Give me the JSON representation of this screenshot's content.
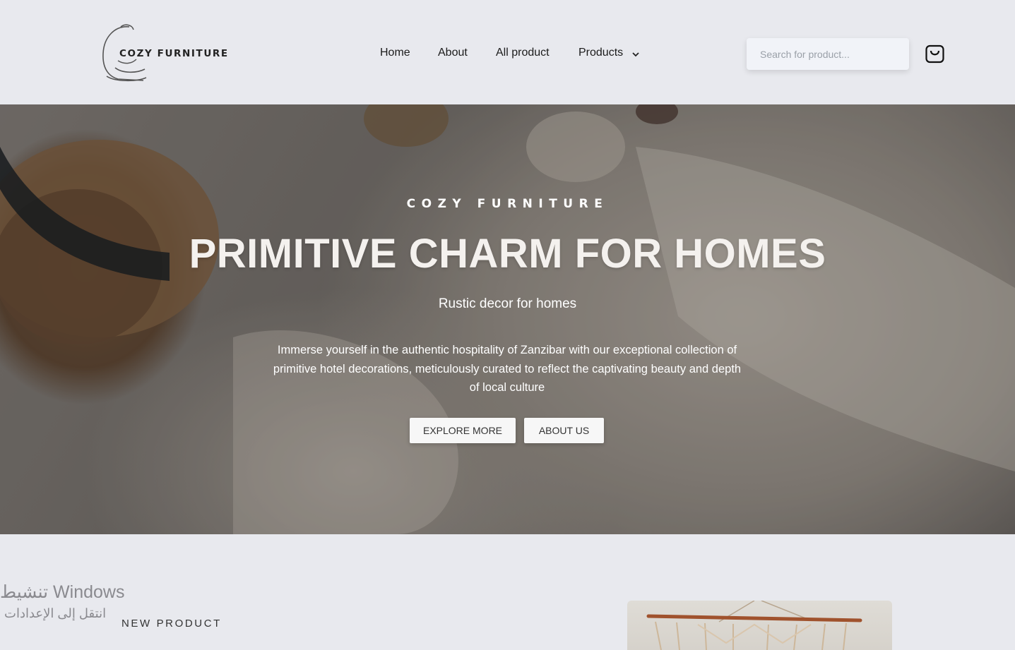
{
  "header": {
    "logo_text": "COZY FURNITURE",
    "nav": [
      {
        "label": "Home"
      },
      {
        "label": "About"
      },
      {
        "label": "All product"
      },
      {
        "label": "Products"
      }
    ],
    "search_placeholder": "Search for product...",
    "cart_icon": "shopping-bag-icon"
  },
  "hero": {
    "eyebrow": "COZY FURNITURE",
    "title": "PRIMITIVE CHARM FOR HOMES",
    "subtitle": "Rustic decor for homes",
    "description": "Immerse yourself in the authentic hospitality of Zanzibar with our exceptional collection of primitive hotel decorations, meticulously curated to reflect the captivating beauty and depth of local culture",
    "buttons": {
      "explore": "EXPLORE MORE",
      "about": "ABOUT US"
    }
  },
  "watermark": {
    "line1": "تنشيط Windows",
    "line2": "انتقل إلى الإعدادات"
  },
  "section": {
    "new_product_label": "NEW PRODUCT"
  },
  "colors": {
    "background": "#e8e9ee",
    "search_bg": "#f1f3f8",
    "button_bg": "#f7f7f7"
  }
}
